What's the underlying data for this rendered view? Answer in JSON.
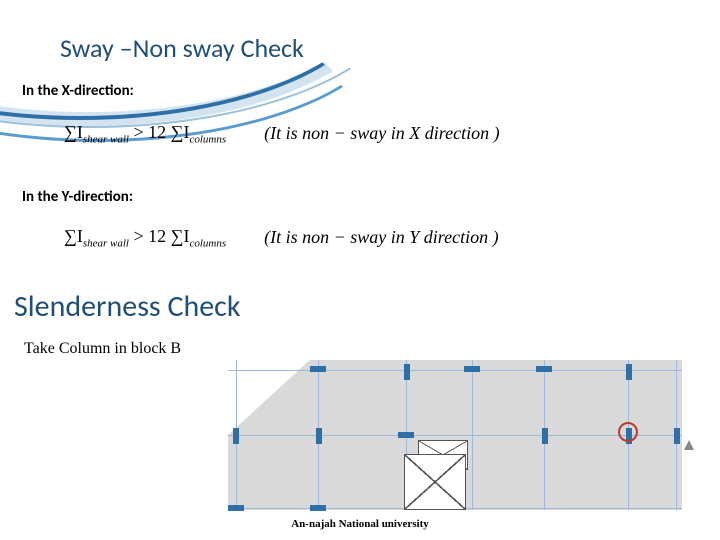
{
  "heading1": "Sway –Non sway Check",
  "x_dir_label": "In the X-direction:",
  "y_dir_label": "In the Y-direction:",
  "formula_x": {
    "lhs_sigma1": "∑I",
    "lhs_sub1": "shear wall",
    "gt": " > 12 ",
    "lhs_sigma2": "∑I",
    "lhs_sub2": "columns",
    "rhs": "(It is non − sway in X direction )"
  },
  "formula_y": {
    "lhs_sigma1": "∑I",
    "lhs_sub1": "shear wall",
    "gt": " > 12 ",
    "lhs_sigma2": "∑I",
    "lhs_sub2": "columns",
    "rhs": "(It is non − sway in Y direction )"
  },
  "heading2": "Slenderness Check",
  "take_column": "Take Column in block B",
  "footer": "An-najah National university"
}
